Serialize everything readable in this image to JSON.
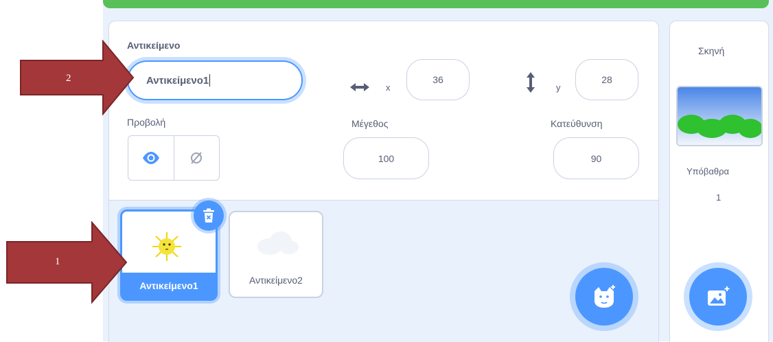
{
  "sprite_info": {
    "label_sprite": "Αντικείμενο",
    "sprite_name": "Αντικείμενο1",
    "x_label": "x",
    "x_value": "36",
    "y_label": "y",
    "y_value": "28",
    "label_show": "Προβολή",
    "label_size": "Μέγεθος",
    "size_value": "100",
    "label_direction": "Κατεύθυνση",
    "direction_value": "90"
  },
  "sprites": [
    {
      "name": "Αντικείμενο1",
      "selected": true
    },
    {
      "name": "Αντικείμενο2",
      "selected": false
    }
  ],
  "stage": {
    "title": "Σκηνή",
    "backdrops_label": "Υπόβαθρα",
    "backdrops_count": "1"
  },
  "annotations": [
    {
      "label": "1"
    },
    {
      "label": "2"
    }
  ],
  "colors": {
    "accent": "#4c97ff",
    "top_strip": "#59c059",
    "arrow_fill": "#a4373a",
    "arrow_stroke": "#7a2528"
  }
}
